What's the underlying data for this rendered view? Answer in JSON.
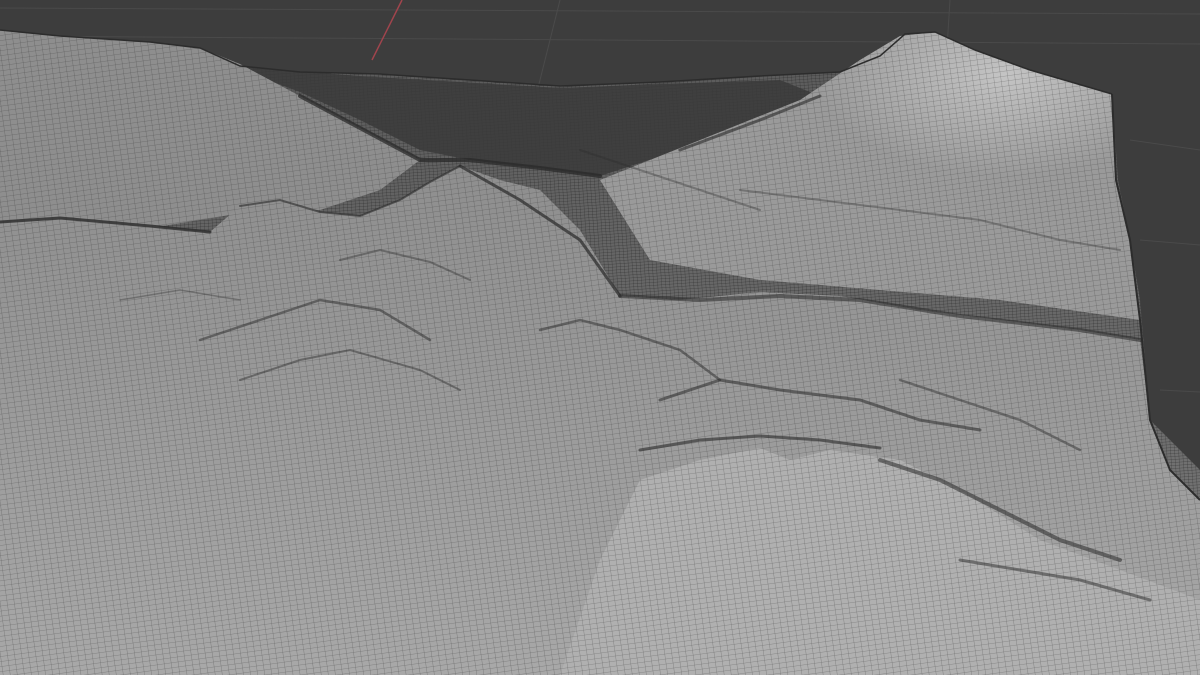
{
  "viewport": {
    "mode": "3d-viewport",
    "shading": "solid-wireframe-overlay",
    "background_color": "#3d3d3d",
    "grid_line_color": "#4a4a4a",
    "x_axis_color": "#a0444d"
  },
  "object": {
    "type": "terrain-mesh",
    "surface_color": "#a3a3a3",
    "wire_color": "#1c1c1c"
  }
}
